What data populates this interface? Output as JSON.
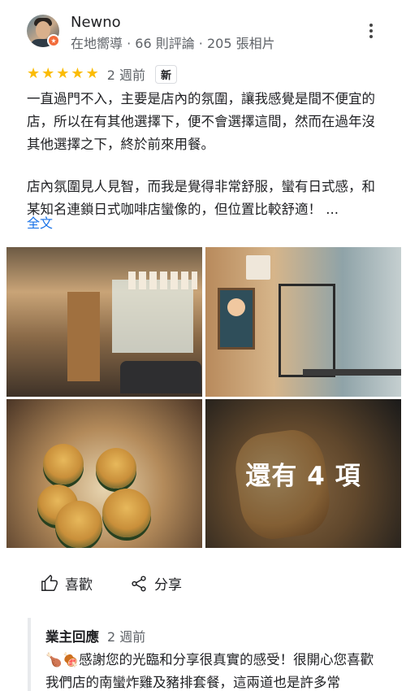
{
  "reviewer": {
    "name": "Newno",
    "meta": "在地嚮導 · 66 則評論 · 205 張相片"
  },
  "review": {
    "stars": 5,
    "date": "2 週前",
    "new_badge": "新",
    "paragraph_1": "一直過門不入，主要是店內的氛圍，讓我感覺是間不便宜的店，所以在有其他選擇下，便不會選擇這間，然而在過年沒其他選擇之下，終於前來用餐。",
    "paragraph_2": "店內氛圍見人見智，而我是覺得非常舒服，蠻有日式感，和某知名連鎖日式咖啡店蠻像的，但位置比較舒適！ ...",
    "full_text_link": "全文"
  },
  "photos": {
    "more_label": "還有 4 項"
  },
  "actions": {
    "like_label": "喜歡",
    "share_label": "分享"
  },
  "owner_reply": {
    "title": "業主回應",
    "date": "2 週前",
    "text": "🍗🍖感謝您的光臨和分享很真實的感受！很開心您喜歡我們店的南蠻炸雞及豬排套餐，這兩道也是許多常"
  },
  "colors": {
    "star": "#fbbc04",
    "link": "#1a73e8",
    "badge": "#f26b3a"
  }
}
